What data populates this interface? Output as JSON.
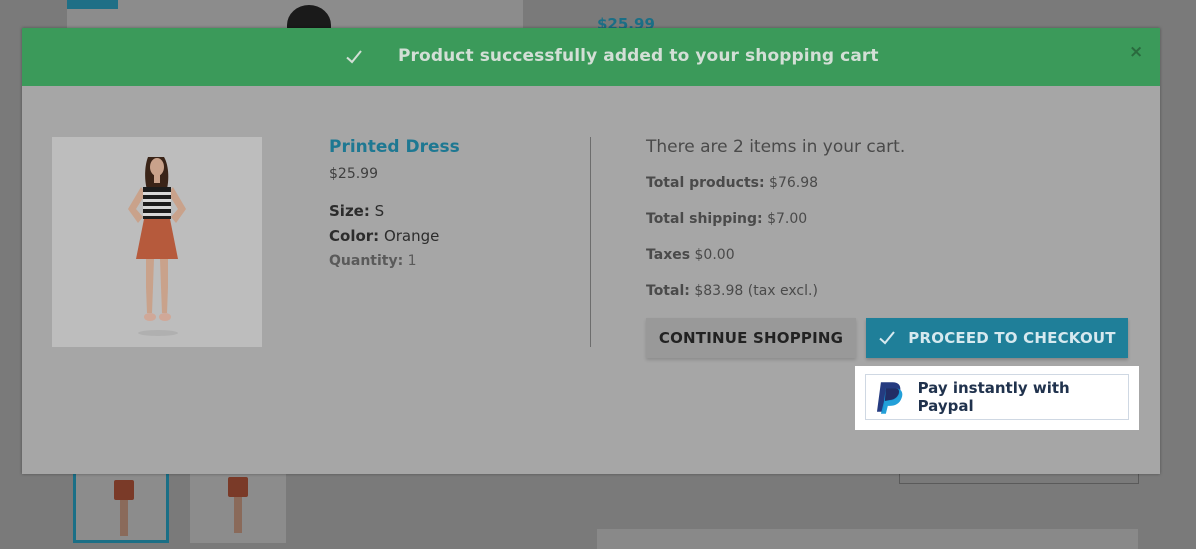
{
  "background": {
    "price": "$25.99"
  },
  "modal": {
    "header_title": "Product successfully added to your shopping cart",
    "close_label": "×",
    "product": {
      "name": "Printed Dress",
      "price": "$25.99",
      "size_label": "Size:",
      "size_value": "S",
      "color_label": "Color:",
      "color_value": "Orange",
      "quantity_label": "Quantity:",
      "quantity_value": "1"
    },
    "cart": {
      "count_text": "There are 2 items in your cart.",
      "total_products_label": "Total products:",
      "total_products_value": "$76.98",
      "total_shipping_label": "Total shipping:",
      "total_shipping_value": "$7.00",
      "taxes_label": "Taxes",
      "taxes_value": "$0.00",
      "total_label": "Total:",
      "total_value": "$83.98 (tax excl.)"
    },
    "buttons": {
      "continue_label": "CONTINUE SHOPPING",
      "checkout_label": "PROCEED TO CHECKOUT",
      "paypal_label": "Pay instantly with Paypal"
    }
  },
  "colors": {
    "success_header": "#3b9a5a",
    "accent": "#1f7f99",
    "paypal_dark": "#253b80",
    "paypal_light": "#179bd7"
  },
  "icons": {
    "header": "check-icon",
    "checkout": "check-icon",
    "close": "close-icon",
    "paypal": "paypal-logo-icon"
  }
}
